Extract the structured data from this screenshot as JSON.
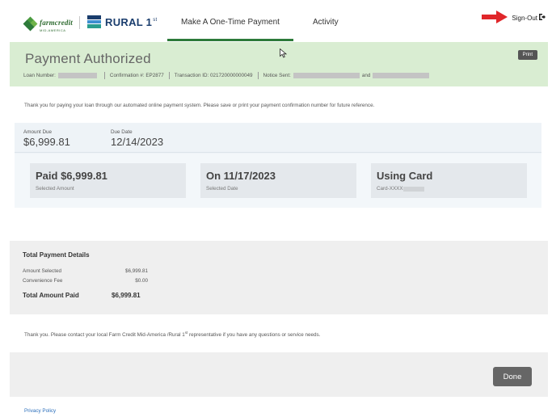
{
  "header": {
    "logo_fc_name": "farmcredit",
    "logo_fc_sub": "MID-AMERICA",
    "logo_r1_name": "RURAL 1",
    "logo_r1_sup": "st",
    "tabs": [
      {
        "label": "Make A One-Time Payment",
        "active": true
      },
      {
        "label": "Activity",
        "active": false
      }
    ],
    "signout_label": "Sign-Out",
    "accent_color": "#2d7a3a"
  },
  "banner": {
    "title": "Payment Authorized",
    "print_label": "Print",
    "loan_label": "Loan Number:",
    "confirmation_label": "Confirmation #:",
    "confirmation_value": "EP2877",
    "transaction_label": "Transaction ID:",
    "transaction_value": "021720000000049",
    "notice_label": "Notice Sent:",
    "notice_and": "and",
    "background_color": "#d9edd2"
  },
  "messages": {
    "thanks_top": "Thank you for paying your loan through our automated online payment system. Please save or print your payment confirmation number for future reference.",
    "thanks_bottom_pre": "Thank you. Please contact your local Farm Credit Mid-America /Rural 1",
    "thanks_bottom_sup": "st",
    "thanks_bottom_post": " representative if you have any questions or service needs."
  },
  "summary": {
    "amount_due_label": "Amount Due",
    "amount_due_value": "$6,999.81",
    "due_date_label": "Due Date",
    "due_date_value": "12/14/2023",
    "cards": [
      {
        "title": "Paid $6,999.81",
        "subtitle": "Selected Amount"
      },
      {
        "title": "On 11/17/2023",
        "subtitle": "Selected Date"
      },
      {
        "title": "Using Card",
        "subtitle": "Card-XXXX"
      }
    ]
  },
  "totals": {
    "title": "Total Payment Details",
    "rows": [
      {
        "label": "Amount Selected",
        "value": "$6,999.81"
      },
      {
        "label": "Convenience Fee",
        "value": "$0.00"
      }
    ],
    "total_label": "Total Amount Paid",
    "total_value": "$6,999.81"
  },
  "footer": {
    "done_label": "Done",
    "privacy_label": "Privacy Policy"
  }
}
